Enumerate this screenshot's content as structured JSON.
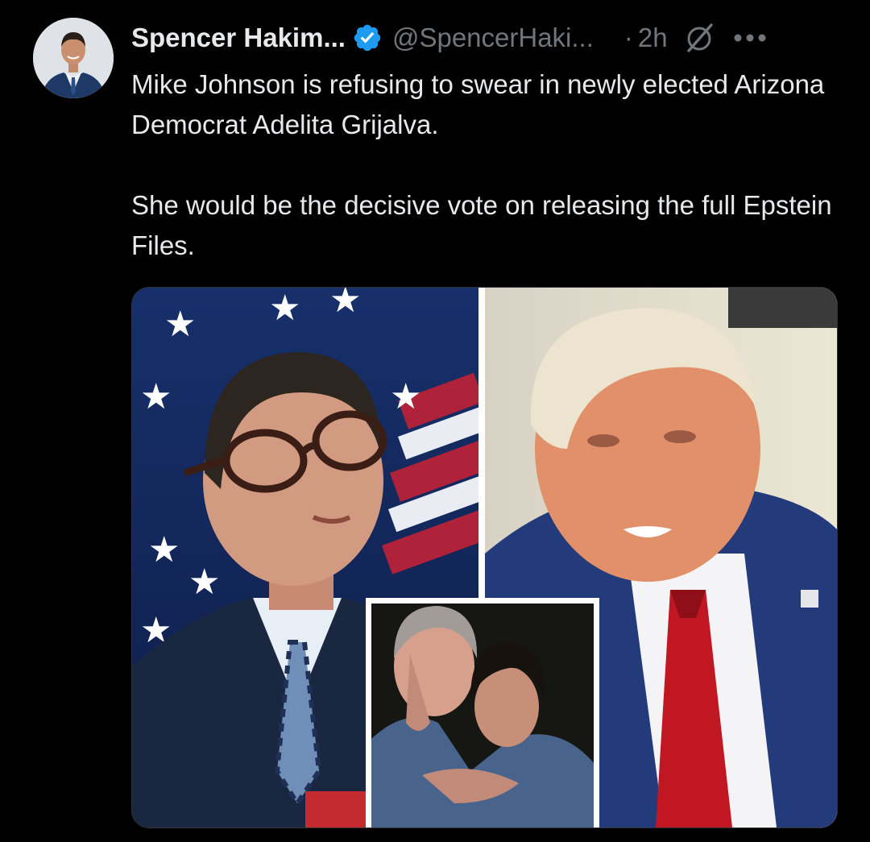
{
  "tweet": {
    "author_name": "Spencer Hakim...",
    "handle": "@SpencerHaki...",
    "separator": "·",
    "time": "2h",
    "paragraphs": [
      "Mike Johnson is refusing to swear in newly elected Arizona Democrat Adelita Grijalva.",
      "She would be the decisive vote on releasing the full Epstein Files."
    ]
  },
  "icons": {
    "verified": "verified-badge-icon",
    "grok": "grok-icon",
    "more": "more-options-icon"
  },
  "colors": {
    "background": "#000000",
    "text": "#e7e9ea",
    "secondary": "#71767b",
    "verified": "#1d9bf0"
  }
}
